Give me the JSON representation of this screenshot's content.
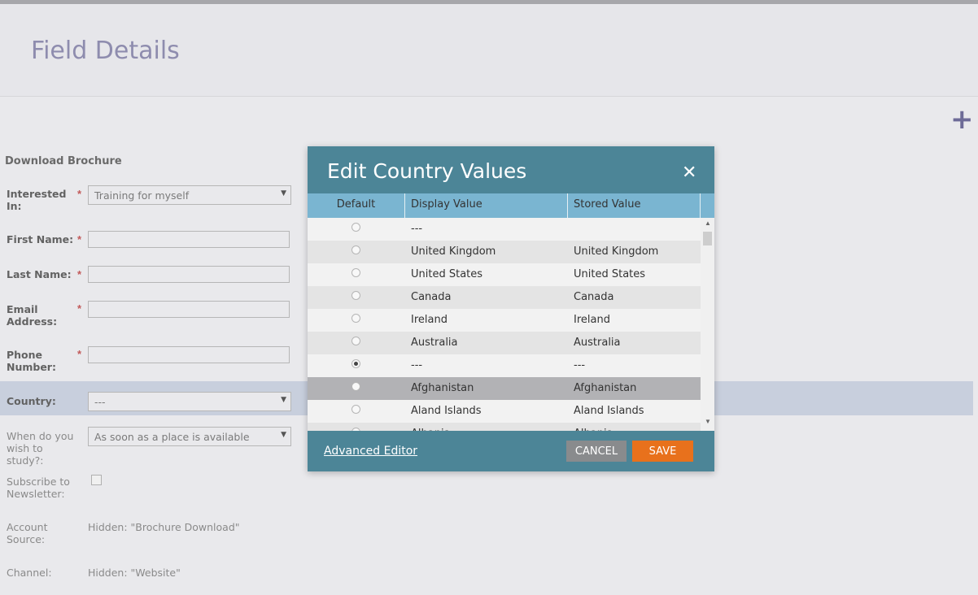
{
  "page": {
    "title": "Field Details",
    "add_icon": "plus-icon"
  },
  "form": {
    "title": "Download Brochure",
    "interested": {
      "label": "Interested In:",
      "required": "*",
      "value": "Training for myself"
    },
    "first_name": {
      "label": "First Name:",
      "required": "*"
    },
    "last_name": {
      "label": "Last Name:",
      "required": "*"
    },
    "email": {
      "label": "Email Address:",
      "required": "*"
    },
    "phone": {
      "label": "Phone Number:",
      "required": "*"
    },
    "country": {
      "label": "Country:",
      "value": "---"
    },
    "study": {
      "label": "When do you wish to study?:",
      "value": "As soon as a place is available"
    },
    "newsletter": {
      "label": "Subscribe to Newsletter:"
    },
    "account_source": {
      "label": "Account Source:",
      "value": "Hidden: \"Brochure Download\""
    },
    "channel": {
      "label": "Channel:",
      "value": "Hidden: \"Website\""
    }
  },
  "modal": {
    "title": "Edit Country Values",
    "close_icon": "close-icon",
    "headers": {
      "default": "Default",
      "display": "Display Value",
      "stored": "Stored Value"
    },
    "rows": [
      {
        "display": "---",
        "stored": "",
        "default": false
      },
      {
        "display": "United Kingdom",
        "stored": "United Kingdom",
        "default": false
      },
      {
        "display": "United States",
        "stored": "United States",
        "default": false
      },
      {
        "display": "Canada",
        "stored": "Canada",
        "default": false
      },
      {
        "display": "Ireland",
        "stored": "Ireland",
        "default": false
      },
      {
        "display": "Australia",
        "stored": "Australia",
        "default": false
      },
      {
        "display": "---",
        "stored": "---",
        "default": true
      },
      {
        "display": "Afghanistan",
        "stored": "Afghanistan",
        "default": false,
        "selected": true
      },
      {
        "display": "Aland Islands",
        "stored": "Aland Islands",
        "default": false
      },
      {
        "display": "Albania",
        "stored": "Albania",
        "default": false
      }
    ],
    "advanced_editor": "Advanced Editor",
    "cancel": "CANCEL",
    "save": "SAVE"
  },
  "colors": {
    "modal_bg": "#4c8597",
    "table_header": "#7ab5d1",
    "save_button": "#e8711c",
    "cancel_button": "#898b8d"
  }
}
